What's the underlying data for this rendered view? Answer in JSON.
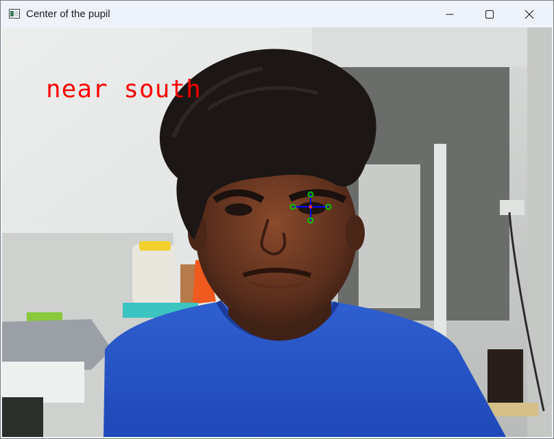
{
  "window": {
    "title": "Center of the pupil",
    "app_icon": "opencv-window-icon",
    "controls": [
      "minimize-icon",
      "maximize-icon",
      "close-icon"
    ]
  },
  "video": {
    "overlay_text": "near south",
    "overlay_color": "#ff0000",
    "pupil_marker_color": "#00c800",
    "pupil_line_color": "#0000ff"
  }
}
